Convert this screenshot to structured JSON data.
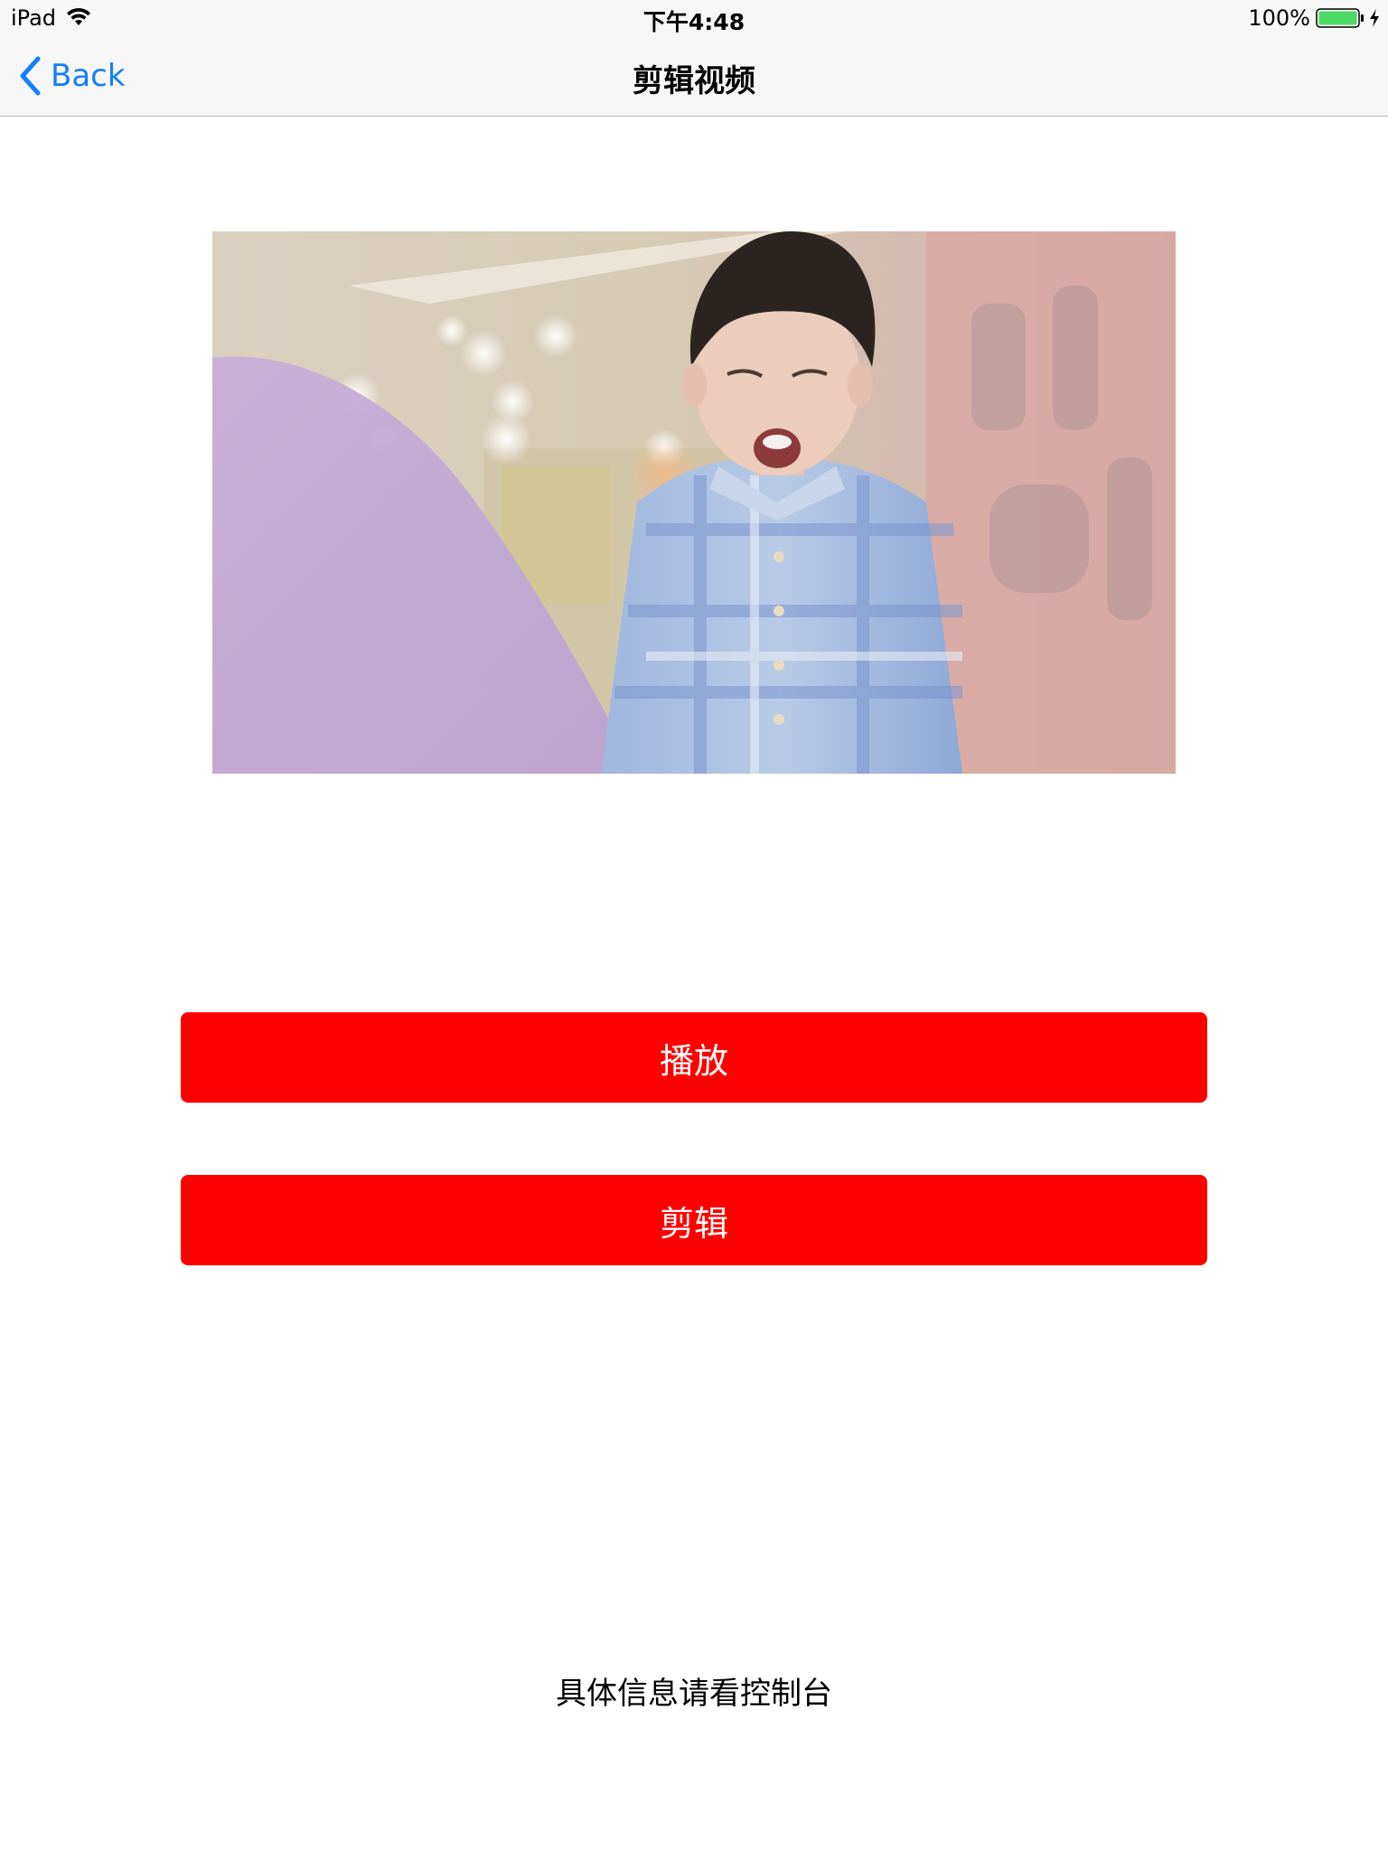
{
  "status_bar": {
    "device": "iPad",
    "time": "下午4:48",
    "battery_percent": "100%",
    "battery_color": "#4cd964",
    "icons": [
      "wifi-icon",
      "battery-icon",
      "charging-bolt-icon"
    ]
  },
  "nav": {
    "back_label": "Back",
    "title": "剪辑视频",
    "tint_color": "#147efb"
  },
  "video": {
    "description_icon": "video-thumbnail"
  },
  "buttons": {
    "play_label": "播放",
    "clip_label": "剪辑",
    "color": "#ff0000"
  },
  "info": {
    "text": "具体信息请看控制台"
  }
}
